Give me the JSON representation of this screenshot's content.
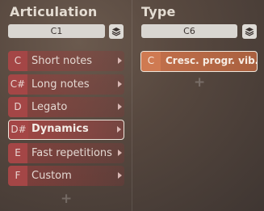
{
  "articulation": {
    "title": "Articulation",
    "key": "C1",
    "items": [
      {
        "key": "C",
        "label": "Short notes",
        "selected": false
      },
      {
        "key": "C#",
        "label": "Long notes",
        "selected": false
      },
      {
        "key": "D",
        "label": "Legato",
        "selected": false
      },
      {
        "key": "D#",
        "label": "Dynamics",
        "selected": true
      },
      {
        "key": "E",
        "label": "Fast repetitions",
        "selected": false
      },
      {
        "key": "F",
        "label": "Custom",
        "selected": false
      }
    ],
    "add_label": "+"
  },
  "type": {
    "title": "Type",
    "key": "C6",
    "items": [
      {
        "key": "C",
        "label": "Cresc. progr. vib.",
        "selected": true
      }
    ],
    "add_label": "+"
  },
  "icons": {
    "layers": "layers-icon",
    "arrow": "chevron-right-icon"
  },
  "colors": {
    "articulation_item": "#a44646",
    "type_item": "#c4714c",
    "selected_border": "#eee6dc"
  }
}
